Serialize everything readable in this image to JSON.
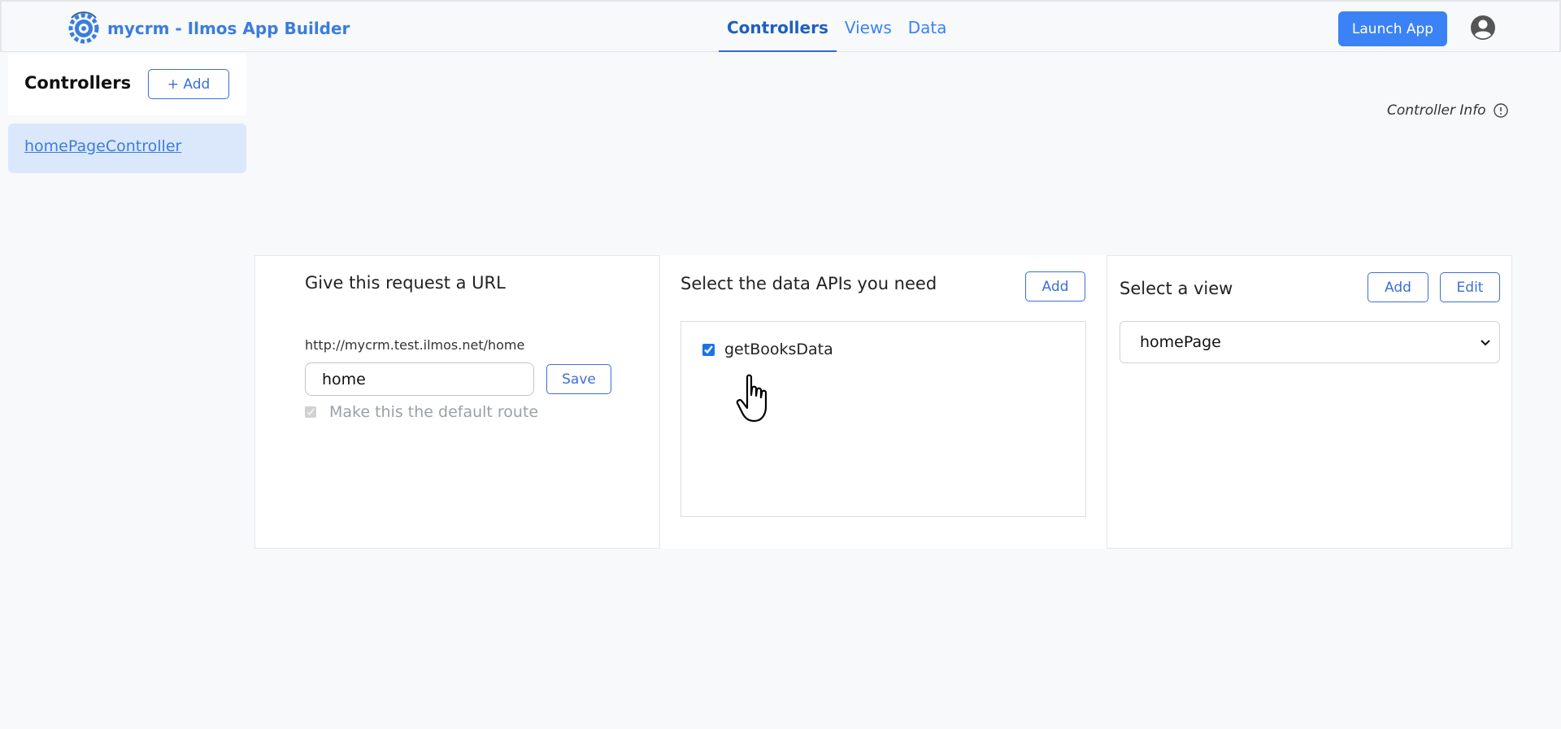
{
  "header": {
    "brand_title": "mycrm - Ilmos App Builder",
    "tabs": [
      {
        "label": "Controllers",
        "active": true
      },
      {
        "label": "Views",
        "active": false
      },
      {
        "label": "Data",
        "active": false
      }
    ],
    "launch_label": "Launch App",
    "icons": {
      "logo": "gear-logo-icon",
      "user": "user-circle-icon"
    },
    "accent_color": "#3b82f6"
  },
  "sidebar": {
    "title": "Controllers",
    "add_label": "+ Add",
    "items": [
      {
        "label": "homePageController",
        "selected": true
      }
    ]
  },
  "controller_info": {
    "label": "Controller Info",
    "icon": "info-icon"
  },
  "url_panel": {
    "title": "Give this request a URL",
    "prefix": "http://mycrm.test.ilmos.net/home",
    "input_value": "home",
    "save_label": "Save",
    "default_route_label": "Make this the default route",
    "default_route_checked": true
  },
  "api_panel": {
    "title": "Select the data APIs you need",
    "add_label": "Add",
    "items": [
      {
        "label": "getBooksData",
        "checked": true
      }
    ]
  },
  "view_panel": {
    "title": "Select a view",
    "add_label": "Add",
    "edit_label": "Edit",
    "selected_view": "homePage"
  }
}
